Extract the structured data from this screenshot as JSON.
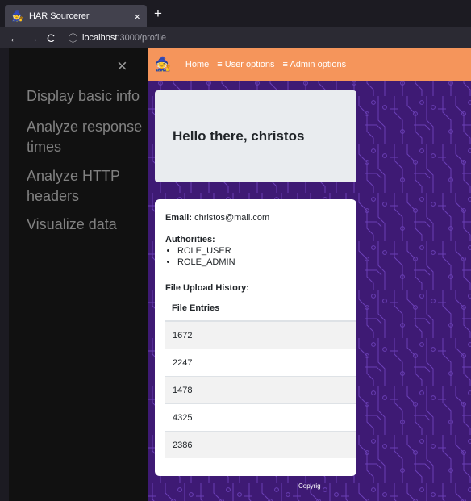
{
  "browser": {
    "tab_title": "HAR Sourcerer",
    "tab_close": "×",
    "new_tab": "+",
    "back": "←",
    "forward": "→",
    "reload": "C",
    "info": "ⓘ",
    "url_host": "localhost",
    "url_path": ":3000/profile"
  },
  "sidebar": {
    "close_label": "×",
    "items": [
      {
        "label": "Display basic info"
      },
      {
        "label": "Analyze response times"
      },
      {
        "label": "Analyze HTTP headers"
      },
      {
        "label": "Visualize data"
      }
    ]
  },
  "topnav": {
    "logo": "🧙",
    "home": "Home",
    "user_options": "≡ User options",
    "admin_options": "≡ Admin options"
  },
  "profile": {
    "greeting": "Hello there, christos",
    "email_label": "Email:",
    "email_value": "christos@mail.com",
    "authorities_label": "Authorities:",
    "authorities": [
      "ROLE_USER",
      "ROLE_ADMIN"
    ],
    "upload_history_label": "File Upload History:",
    "table": {
      "header": "File Entries",
      "rows": [
        "1672",
        "2247",
        "1478",
        "4325",
        "2386"
      ]
    }
  },
  "footer": {
    "copyright": "Copyrig"
  },
  "colors": {
    "nav_accent": "#f5955b",
    "background_purple": "#3e1a74",
    "sidebar_bg": "#111111"
  }
}
